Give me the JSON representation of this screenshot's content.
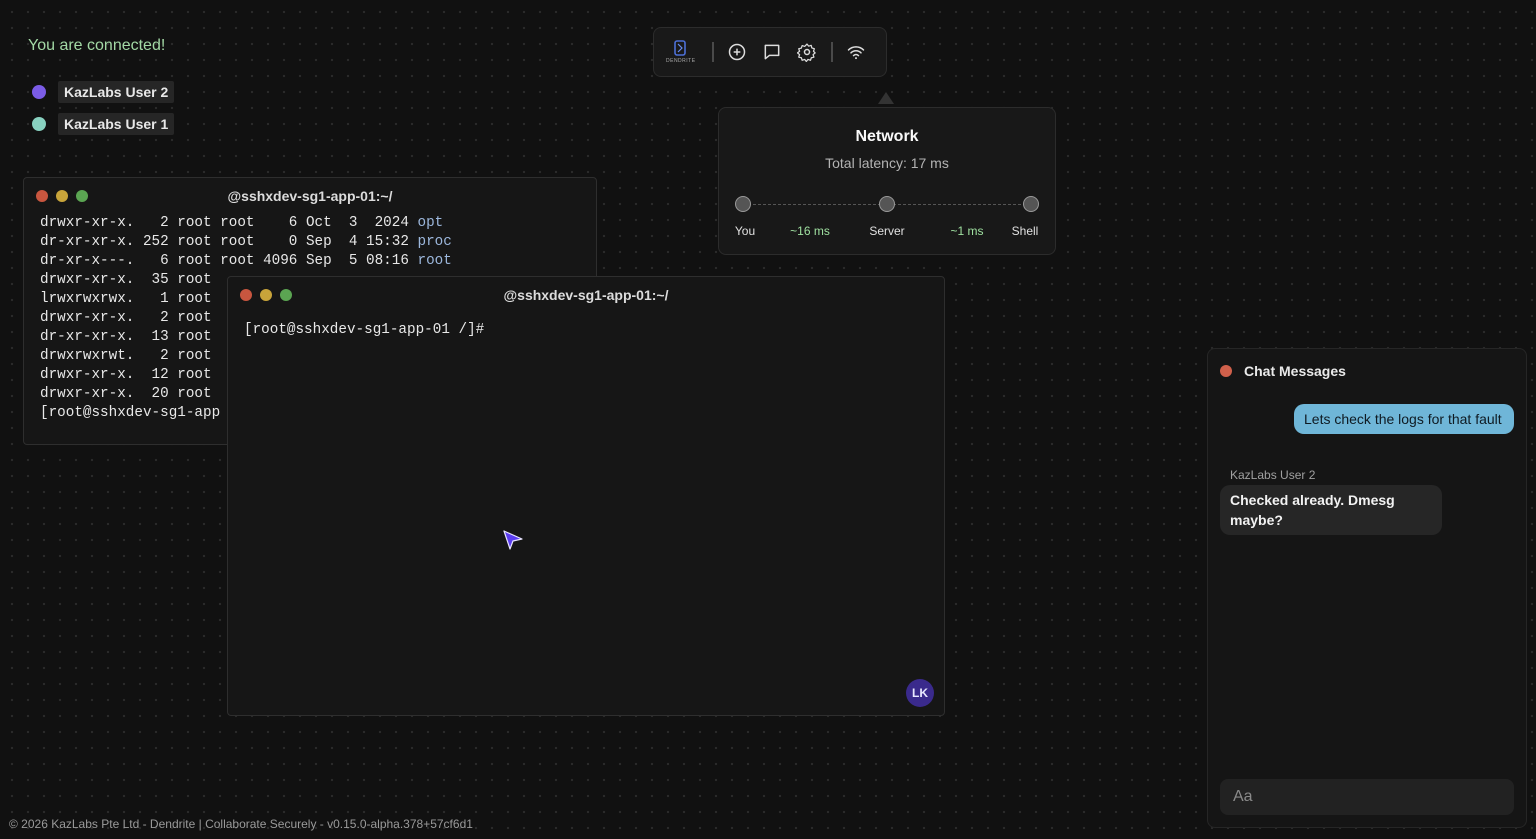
{
  "status": "You are connected!",
  "users": [
    {
      "name": "KazLabs User 2",
      "color": "#7b5ce6"
    },
    {
      "name": "KazLabs User 1",
      "color": "#88d1c0"
    }
  ],
  "toolbar": {
    "logo_text": "DENDRITE",
    "icons": [
      "dendrite-logo-icon",
      "plus-circle-icon",
      "chat-bubble-icon",
      "gear-icon",
      "wifi-icon"
    ]
  },
  "network": {
    "title": "Network",
    "latency": "Total latency: 17 ms",
    "nodes": [
      "You",
      "Server",
      "Shell"
    ],
    "hops": [
      "~16 ms",
      "~1 ms"
    ]
  },
  "term1": {
    "title": "@sshxdev-sg1-app-01:~/",
    "lines": [
      {
        "text": "drwxr-xr-x.   2 root root    6 Oct  3  2024 ",
        "dir": "opt"
      },
      {
        "text": "dr-xr-xr-x. 252 root root    0 Sep  4 15:32 ",
        "dir": "proc"
      },
      {
        "text": "dr-xr-x---.   6 root root 4096 Sep  5 08:16 ",
        "dir": "root"
      },
      {
        "text": "drwxr-xr-x.  35 root ",
        "dir": ""
      },
      {
        "text": "lrwxrwxrwx.   1 root ",
        "dir": ""
      },
      {
        "text": "drwxr-xr-x.   2 root ",
        "dir": ""
      },
      {
        "text": "dr-xr-xr-x.  13 root ",
        "dir": ""
      },
      {
        "text": "drwxrwxrwt.   2 root ",
        "dir": ""
      },
      {
        "text": "drwxr-xr-x.  12 root ",
        "dir": ""
      },
      {
        "text": "drwxr-xr-x.  20 root ",
        "dir": ""
      },
      {
        "text": "[root@sshxdev-sg1-app",
        "dir": ""
      }
    ]
  },
  "term2": {
    "title": "@sshxdev-sg1-app-01:~/",
    "prompt": "[root@sshxdev-sg1-app-01 /]#",
    "avatar": "LK"
  },
  "chat": {
    "title": "Chat Messages",
    "messages": [
      {
        "sender": "",
        "text": "Lets check the logs for that fault",
        "outgoing": true
      },
      {
        "sender": "KazLabs User 2",
        "text": "Checked already. Dmesg maybe?",
        "outgoing": false
      }
    ],
    "input_placeholder": "Aa"
  },
  "footer": "© 2026 KazLabs Pte Ltd - Dendrite | Collaborate Securely - v0.15.0-alpha.378+57cf6d1"
}
